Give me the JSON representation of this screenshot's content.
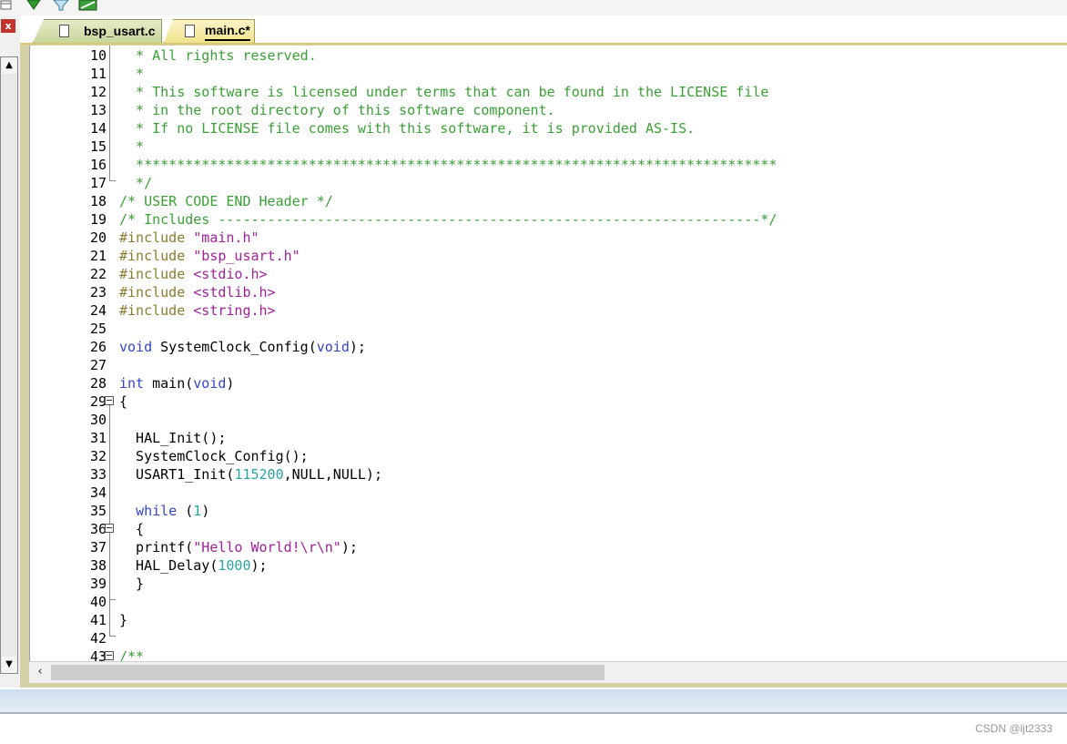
{
  "tabs": [
    {
      "label": "bsp_usart.c",
      "active": false
    },
    {
      "label": "main.c*",
      "active": true
    }
  ],
  "code_lines": [
    {
      "n": "10",
      "parts": [
        {
          "t": "  * All rights reserved.",
          "c": "cm"
        }
      ]
    },
    {
      "n": "11",
      "parts": [
        {
          "t": "  *",
          "c": "cm"
        }
      ]
    },
    {
      "n": "12",
      "parts": [
        {
          "t": "  * This software is licensed under terms that can be found in the LICENSE file",
          "c": "cm"
        }
      ]
    },
    {
      "n": "13",
      "parts": [
        {
          "t": "  * in the root directory of this software component.",
          "c": "cm"
        }
      ]
    },
    {
      "n": "14",
      "parts": [
        {
          "t": "  * If no LICENSE file comes with this software, it is provided AS-IS.",
          "c": "cm"
        }
      ]
    },
    {
      "n": "15",
      "parts": [
        {
          "t": "  *",
          "c": "cm"
        }
      ]
    },
    {
      "n": "16",
      "parts": [
        {
          "t": "  ******************************************************************************",
          "c": "cm"
        }
      ]
    },
    {
      "n": "17",
      "parts": [
        {
          "t": "  */",
          "c": "cm"
        }
      ]
    },
    {
      "n": "18",
      "parts": [
        {
          "t": "/* USER CODE END Header */",
          "c": "cm"
        }
      ]
    },
    {
      "n": "19",
      "parts": [
        {
          "t": "/* Includes ------------------------------------------------------------------*/",
          "c": "cm"
        }
      ]
    },
    {
      "n": "20",
      "parts": [
        {
          "t": "#include ",
          "c": "pp"
        },
        {
          "t": "\"main.h\"",
          "c": "str"
        }
      ]
    },
    {
      "n": "21",
      "parts": [
        {
          "t": "#include ",
          "c": "pp"
        },
        {
          "t": "\"bsp_usart.h\"",
          "c": "str"
        }
      ]
    },
    {
      "n": "22",
      "parts": [
        {
          "t": "#include ",
          "c": "pp"
        },
        {
          "t": "<stdio.h>",
          "c": "str"
        }
      ]
    },
    {
      "n": "23",
      "parts": [
        {
          "t": "#include ",
          "c": "pp"
        },
        {
          "t": "<stdlib.h>",
          "c": "str"
        }
      ]
    },
    {
      "n": "24",
      "parts": [
        {
          "t": "#include ",
          "c": "pp"
        },
        {
          "t": "<string.h>",
          "c": "str"
        }
      ]
    },
    {
      "n": "25",
      "parts": []
    },
    {
      "n": "26",
      "parts": [
        {
          "t": "void",
          "c": "kw"
        },
        {
          "t": " SystemClock_Config(",
          "c": "def"
        },
        {
          "t": "void",
          "c": "kw"
        },
        {
          "t": ");",
          "c": "def"
        }
      ]
    },
    {
      "n": "27",
      "parts": []
    },
    {
      "n": "28",
      "parts": [
        {
          "t": "int",
          "c": "kw"
        },
        {
          "t": " main(",
          "c": "def"
        },
        {
          "t": "void",
          "c": "kw"
        },
        {
          "t": ")",
          "c": "def"
        }
      ]
    },
    {
      "n": "29",
      "parts": [
        {
          "t": "{",
          "c": "def"
        }
      ]
    },
    {
      "n": "30",
      "parts": []
    },
    {
      "n": "31",
      "parts": [
        {
          "t": "  HAL_Init();",
          "c": "def"
        }
      ]
    },
    {
      "n": "32",
      "parts": [
        {
          "t": "  SystemClock_Config();",
          "c": "def"
        }
      ]
    },
    {
      "n": "33",
      "parts": [
        {
          "t": "  USART1_Init(",
          "c": "def"
        },
        {
          "t": "115200",
          "c": "num"
        },
        {
          "t": ",NULL,NULL);",
          "c": "def"
        }
      ]
    },
    {
      "n": "34",
      "parts": []
    },
    {
      "n": "35",
      "parts": [
        {
          "t": "  ",
          "c": "def"
        },
        {
          "t": "while",
          "c": "kw"
        },
        {
          "t": " (",
          "c": "def"
        },
        {
          "t": "1",
          "c": "num"
        },
        {
          "t": ")",
          "c": "def"
        }
      ]
    },
    {
      "n": "36",
      "parts": [
        {
          "t": "  {",
          "c": "def"
        }
      ]
    },
    {
      "n": "37",
      "parts": [
        {
          "t": "  printf(",
          "c": "def"
        },
        {
          "t": "\"Hello World!\\r\\n\"",
          "c": "str"
        },
        {
          "t": ");",
          "c": "def"
        }
      ]
    },
    {
      "n": "38",
      "parts": [
        {
          "t": "  HAL_Delay(",
          "c": "def"
        },
        {
          "t": "1000",
          "c": "num"
        },
        {
          "t": ");",
          "c": "def"
        }
      ]
    },
    {
      "n": "39",
      "parts": [
        {
          "t": "  }",
          "c": "def"
        }
      ]
    },
    {
      "n": "40",
      "parts": []
    },
    {
      "n": "41",
      "parts": [
        {
          "t": "}",
          "c": "def"
        }
      ]
    },
    {
      "n": "42",
      "parts": []
    },
    {
      "n": "43",
      "parts": [
        {
          "t": "/**",
          "c": "cm"
        }
      ]
    }
  ],
  "fold_markers": [
    "29",
    "36",
    "43"
  ],
  "scroll": {
    "left_arrow": "‹",
    "up_arrow": "▲",
    "down_arrow": "▼"
  },
  "close_label": "x",
  "watermark": "CSDN @ljt2333",
  "colors": {
    "comment": "#3aa035",
    "preprocessor": "#8a7b2c",
    "string": "#a0209a",
    "keyword": "#3344cc",
    "number": "#2aa3a3"
  }
}
